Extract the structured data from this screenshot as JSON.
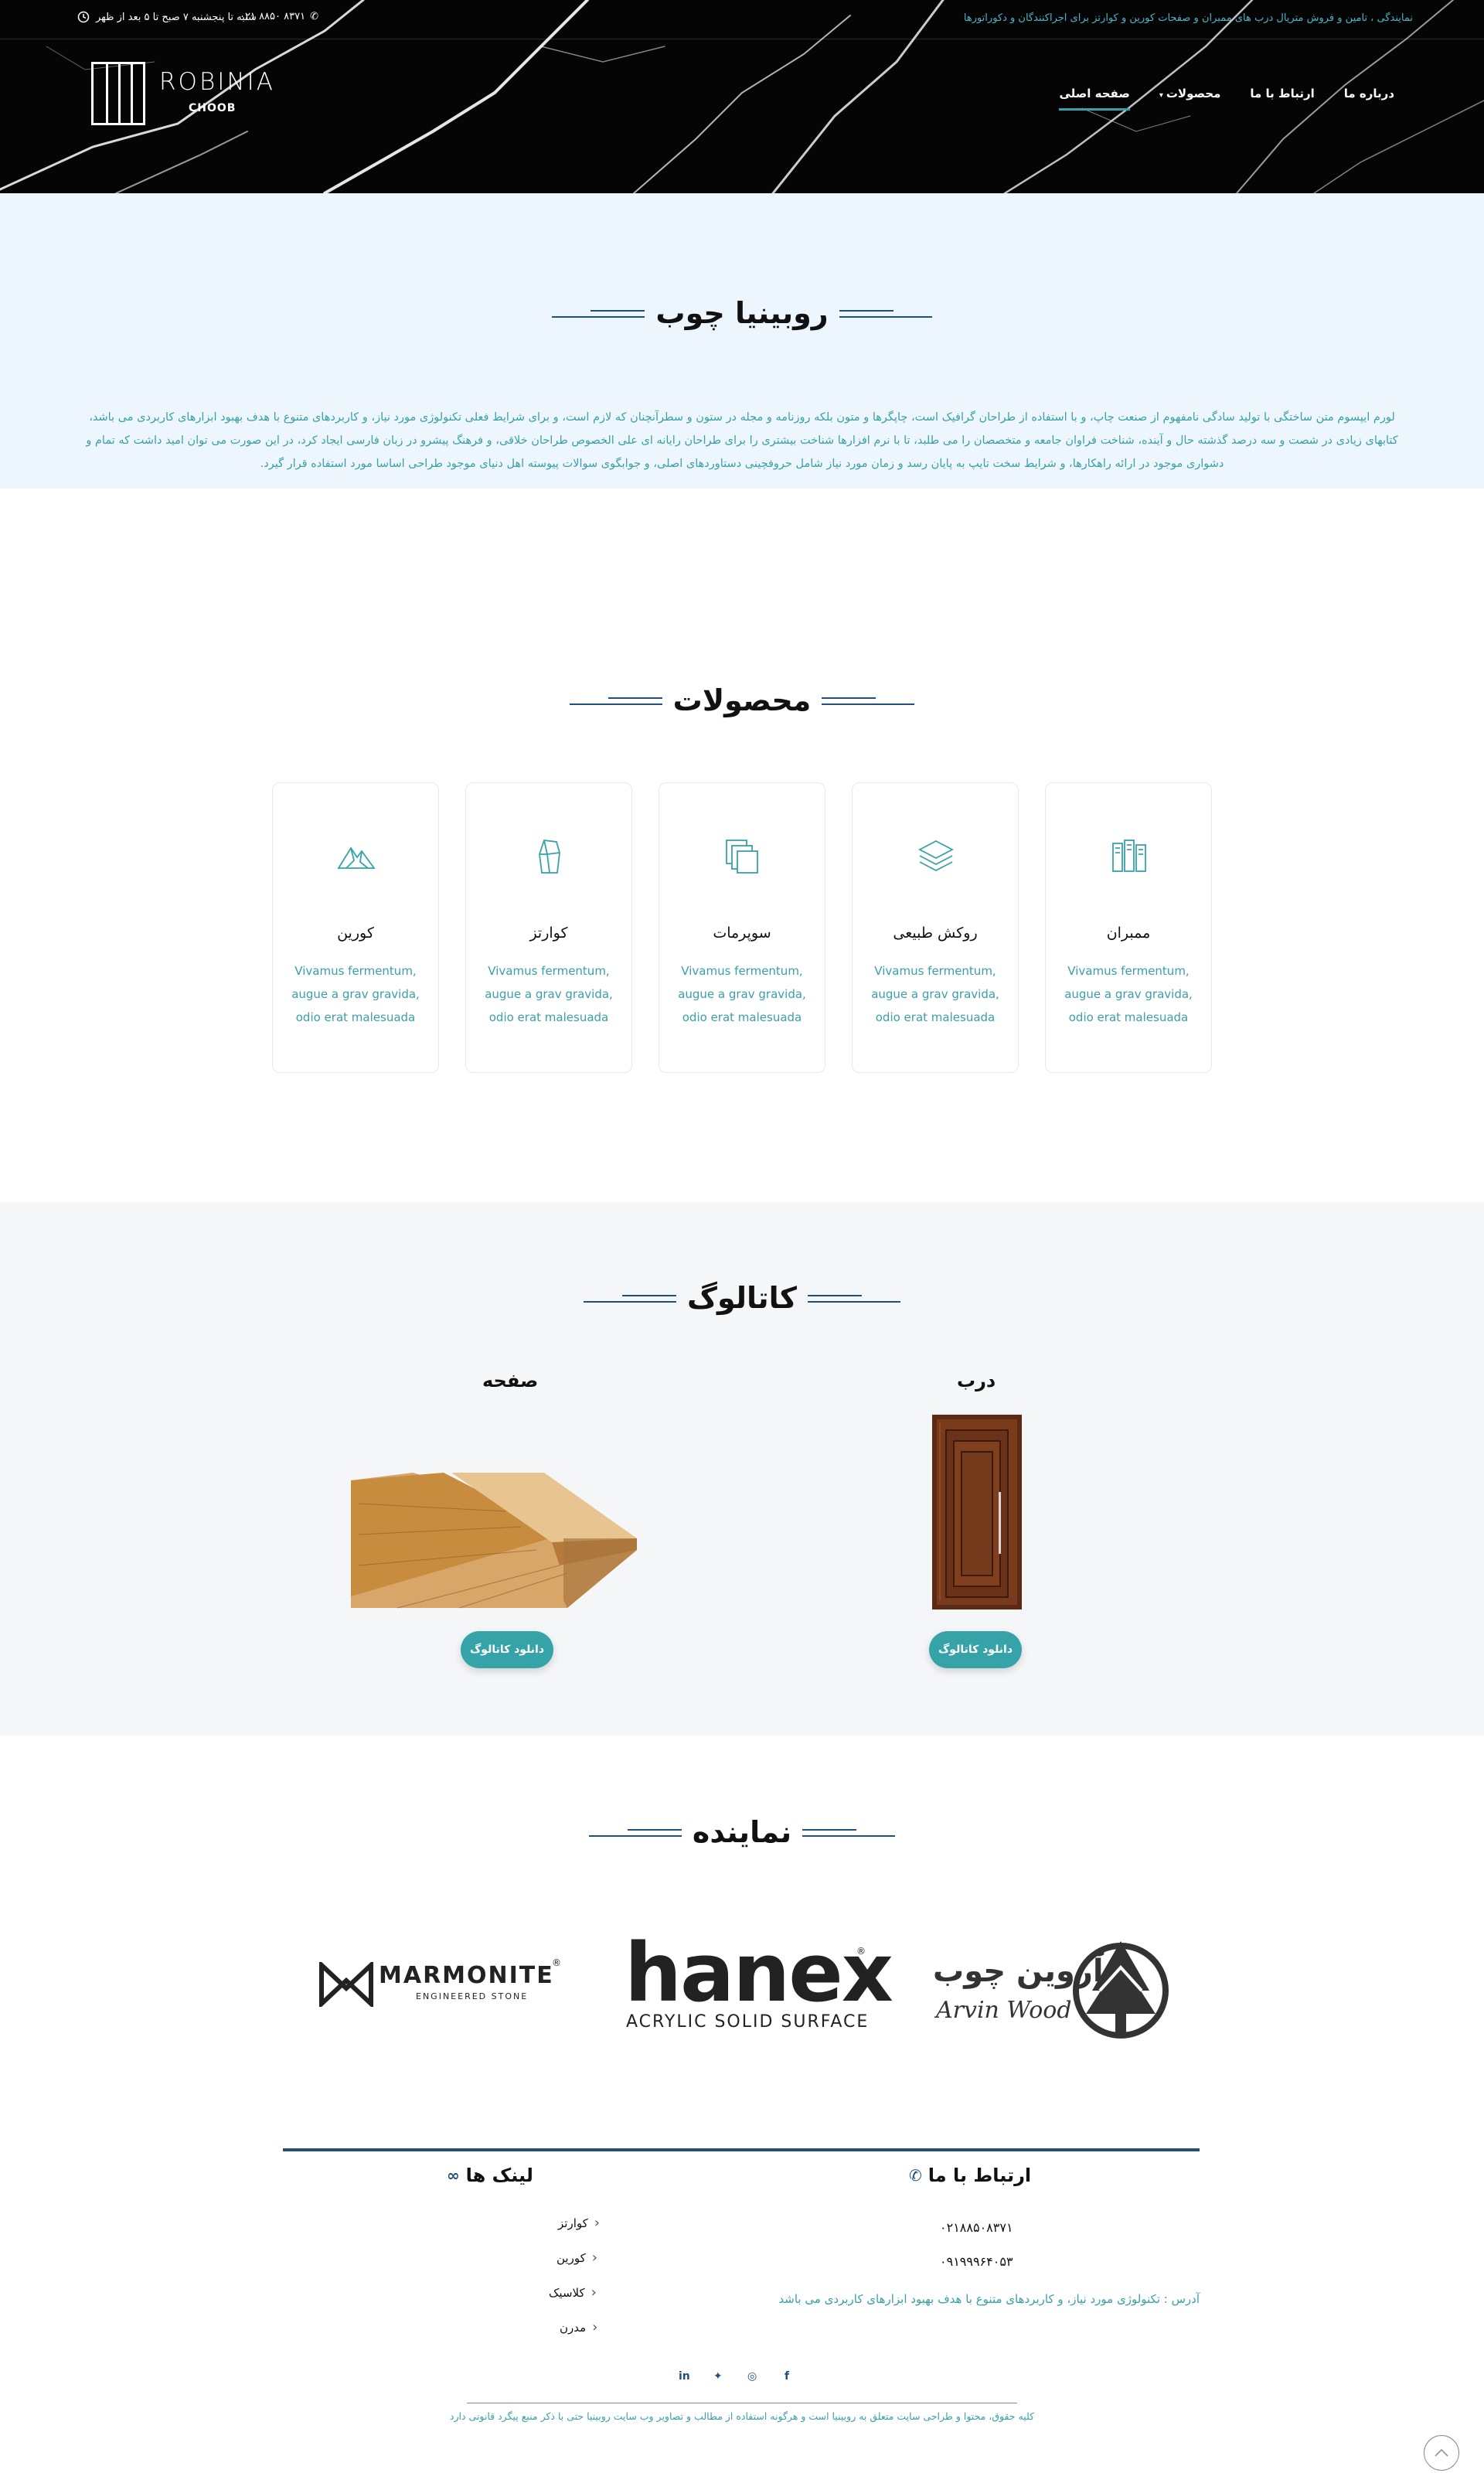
{
  "topbar": {
    "note": "نمایندگی ، تامین و فروش متریال درب های ممبران و صفحات کورین و کوارتز برای اجراکنندگان و دکوراتورها",
    "hours": "شنبه تا پنجشنبه ۷ صبح تا ۵ بعد از ظهر",
    "phone": "۰۲۱ ۸۸۵۰ ۸۳۷۱"
  },
  "logo": {
    "word": "ROBINIA",
    "sub": "CHOOB"
  },
  "nav": {
    "items": [
      {
        "label": "صفحه اصلی",
        "active": true
      },
      {
        "label": "محصولات",
        "dropdown": true
      },
      {
        "label": "ارتباط با ما"
      },
      {
        "label": "درباره ما"
      }
    ]
  },
  "about": {
    "title": "روبینیا چوب",
    "text": "لورم ایپسوم متن ساختگی با تولید سادگی نامفهوم از صنعت چاپ، و با استفاده از طراحان گرافیک است، چاپگرها و متون بلکه روزنامه و مجله در ستون و سطرآنچنان که لازم است، و برای شرایط فعلی تکنولوژی مورد نیاز، و کاربردهای متنوع با هدف بهبود ابزارهای کاربردی می باشد، کتابهای زیادی در شصت و سه درصد گذشته حال و آینده، شناخت فراوان جامعه و متخصصان را می طلبد، تا با نرم افزارها شناخت بیشتری را برای طراحان رایانه ای علی الخصوص طراحان خلاقی، و فرهنگ پیشرو در زبان فارسی ایجاد کرد، در این صورت می توان امید داشت که تمام و دشواری موجود در ارائه راهکارها، و شرایط سخت تایپ به پایان رسد و زمان مورد نیاز شامل حروفچینی دستاوردهای اصلی، و جوابگوی سوالات پیوسته اهل دنیای موجود طراحی اساسا مورد استفاده قرار گیرد."
  },
  "products": {
    "title": "محصولات",
    "items": [
      {
        "title": "ممبران",
        "icon": "panels-icon",
        "desc": "Vivamus fermentum, augue a grav gravida, odio erat malesuada"
      },
      {
        "title": "روکش طبیعی",
        "icon": "layers-icon",
        "desc": "Vivamus fermentum, augue a grav gravida, odio erat malesuada"
      },
      {
        "title": "سوپرمات",
        "icon": "sheets-icon",
        "desc": "Vivamus fermentum, augue a grav gravida, odio erat malesuada"
      },
      {
        "title": "کوارتز",
        "icon": "stone-icon",
        "desc": "Vivamus fermentum, augue a grav gravida, odio erat malesuada"
      },
      {
        "title": "کورین",
        "icon": "mountain-icon",
        "desc": "Vivamus fermentum, augue a grav gravida, odio erat malesuada"
      }
    ]
  },
  "catalog": {
    "title": "کاتالوگ",
    "items": [
      {
        "name": "درب",
        "button": "دانلود کاتالوگ"
      },
      {
        "name": "صفحه",
        "button": "دانلود کاتالوگ"
      }
    ]
  },
  "dealers": {
    "title": "نماینده",
    "brands": [
      {
        "fa": "آروین چوب",
        "en": "Arvin Wood"
      },
      {
        "word": "hanex",
        "tag": "ACRYLIC SOLID SURFACE"
      },
      {
        "word": "MARMONITE",
        "tag": "ENGINEERED STONE"
      }
    ]
  },
  "footer": {
    "contact_title": "ارتباط با ما",
    "phone1": "۰۲۱۸۸۵۰۸۳۷۱",
    "phone2": "۰۹۱۹۹۹۶۴۰۵۳",
    "address": "آدرس : تکنولوژی مورد نیاز، و کاربردهای متنوع با هدف بهبود ابزارهای کاربردی می باشد",
    "links_title": "لینک ها",
    "links": [
      "کوارتز",
      "کورین",
      "کلاسیک",
      "مدرن"
    ],
    "socials": [
      "f",
      "ig",
      "tw",
      "in"
    ],
    "copyright": "کلیه حقوق، محتوا و طراحی سایت متعلق به روبینیا است و هرگونه استفاده از مطالب و تصاویر وب سایت روبینیا حتی با ذکر منبع پیگرد قانونی دارد"
  },
  "colors": {
    "accent": "#36a3a8",
    "navy": "#1f4f7a",
    "about_bg": "#eef6fd",
    "catalog_bg": "#f5f6f8"
  }
}
